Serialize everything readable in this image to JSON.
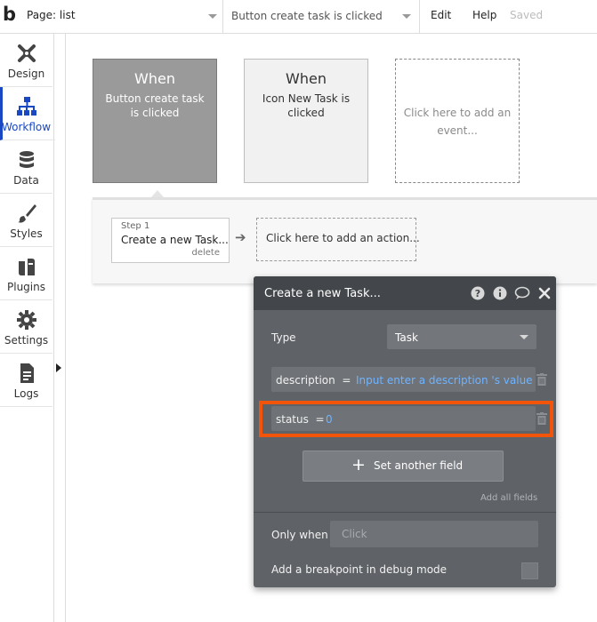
{
  "topbar": {
    "logo": "b",
    "page_selector": "Page: list",
    "workflow_selector": "Button create task is clicked",
    "menu": [
      "Edit",
      "Help"
    ],
    "status": "Saved"
  },
  "sidebar": {
    "active": "Workflow",
    "items": [
      {
        "label": "Design",
        "icon": "design-icon"
      },
      {
        "label": "Workflow",
        "icon": "workflow-icon"
      },
      {
        "label": "Data",
        "icon": "database-icon"
      },
      {
        "label": "Styles",
        "icon": "brush-icon"
      },
      {
        "label": "Plugins",
        "icon": "plugins-icon"
      },
      {
        "label": "Settings",
        "icon": "gear-icon"
      },
      {
        "label": "Logs",
        "icon": "document-icon"
      }
    ]
  },
  "events": [
    {
      "when": "When",
      "description": "Button create task is clicked",
      "selected": true
    },
    {
      "when": "When",
      "description": "Icon New Task is clicked",
      "selected": false
    },
    {
      "description": "Click here to add an event..."
    }
  ],
  "actions": {
    "step_label": "Step 1",
    "step_name": "Create a new Task...",
    "delete_label": "delete",
    "add_action": "Click here to add an action..."
  },
  "panel": {
    "title": "Create a new Task...",
    "type_label": "Type",
    "type_value": "Task",
    "fields": [
      {
        "name": "description",
        "op": "=",
        "value": "Input enter a description 's value"
      },
      {
        "name": "status",
        "op": "=",
        "value": "0"
      }
    ],
    "set_another_field": "Set another field",
    "add_all_fields": "Add all fields",
    "only_when_label": "Only when",
    "only_when_placeholder": "Click",
    "breakpoint_label": "Add a breakpoint in debug mode",
    "highlight_color": "#f2540a"
  }
}
